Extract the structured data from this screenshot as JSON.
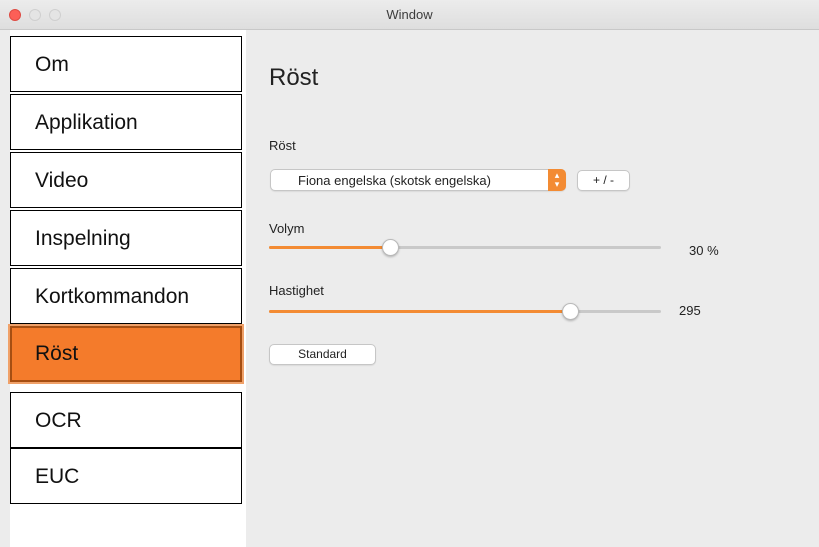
{
  "window": {
    "title": "Window"
  },
  "sidebar": {
    "items": [
      {
        "label": "Om"
      },
      {
        "label": "Applikation"
      },
      {
        "label": "Video"
      },
      {
        "label": "Inspelning"
      },
      {
        "label": "Kortkommandon"
      },
      {
        "label": "Röst",
        "active": true
      },
      {
        "label": "OCR"
      },
      {
        "label": "EUC"
      }
    ]
  },
  "main": {
    "title": "Röst",
    "voice": {
      "label": "Röst",
      "selected": "Fiona engelska (skotsk engelska)",
      "plus_minus_label": "+ / -"
    },
    "volume": {
      "label": "Volym",
      "value": 30,
      "value_text": "30 %"
    },
    "speed": {
      "label": "Hastighet",
      "value_text": "295",
      "fraction": 0.78
    },
    "standard_button": "Standard"
  },
  "colors": {
    "accent": "#f47b2b",
    "close": "#fc5f57"
  }
}
